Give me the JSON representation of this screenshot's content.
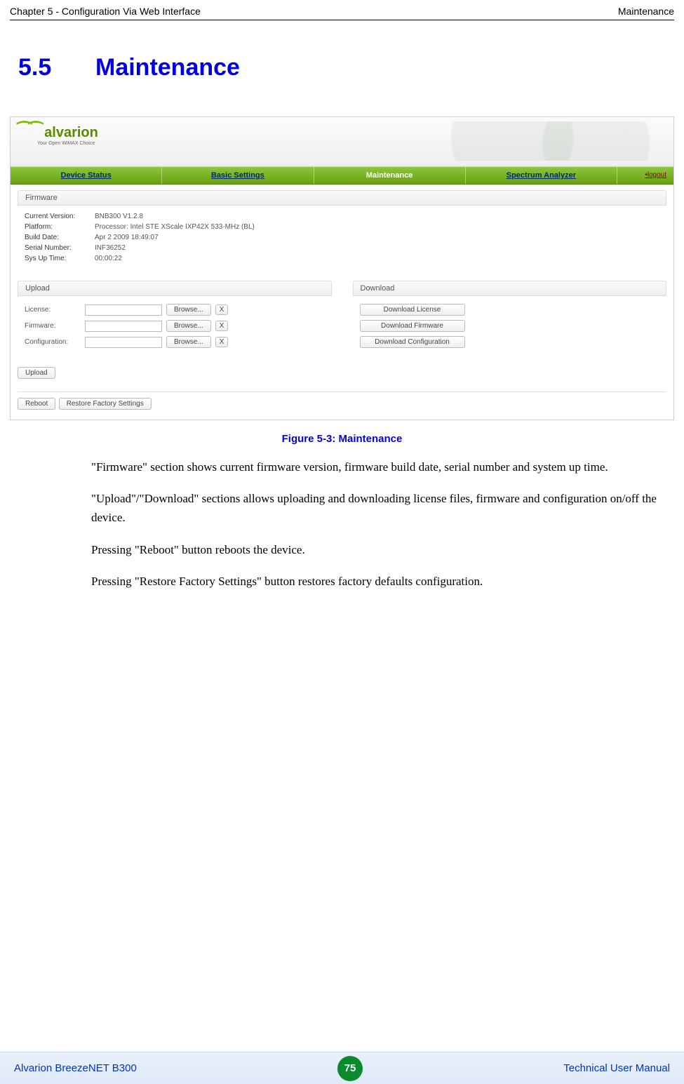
{
  "header": {
    "left": "Chapter 5 - Configuration Via Web Interface",
    "right": "Maintenance"
  },
  "section": {
    "number": "5.5",
    "title": "Maintenance"
  },
  "screenshot": {
    "logo": {
      "brand": "alvarion",
      "tagline": "Your Open WiMAX Choice"
    },
    "nav": {
      "items": [
        "Device Status",
        "Basic Settings",
        "Maintenance",
        "Spectrum Analyzer"
      ],
      "logout": "logout"
    },
    "firmware": {
      "label": "Firmware",
      "rows": [
        {
          "k": "Current Version:",
          "v": "BNB300 V1.2.8"
        },
        {
          "k": "Platform:",
          "v": "Processor: Intel STE XScale IXP42X 533-MHz (BL)"
        },
        {
          "k": "Build Date:",
          "v": "Apr 2 2009 18:49:07"
        },
        {
          "k": "Serial Number:",
          "v": "INF36252"
        },
        {
          "k": "Sys Up Time:",
          "v": "00:00:22"
        }
      ]
    },
    "upload": {
      "label": "Upload",
      "rows": [
        {
          "lbl": "License:",
          "btn": "Browse..."
        },
        {
          "lbl": "Firmware:",
          "btn": "Browse..."
        },
        {
          "lbl": "Configuration:",
          "btn": "Browse..."
        }
      ],
      "submit": "Upload",
      "x": "X"
    },
    "download": {
      "label": "Download",
      "buttons": [
        "Download License",
        "Download Firmware",
        "Download Configuration"
      ]
    },
    "bottom": {
      "reboot": "Reboot",
      "restore": "Restore Factory Settings"
    }
  },
  "caption": "Figure 5-3: Maintenance",
  "paragraphs": [
    "\"Firmware\" section shows current firmware version, firmware build date, serial number and system up time.",
    "\"Upload\"/\"Download\" sections allows uploading and downloading license files, firmware and configuration on/off the device.",
    "Pressing \"Reboot\" button reboots the device.",
    "Pressing \"Restore Factory Settings\" button restores factory defaults configuration."
  ],
  "footer": {
    "left": "Alvarion BreezeNET B300",
    "page": "75",
    "right": "Technical User Manual"
  }
}
